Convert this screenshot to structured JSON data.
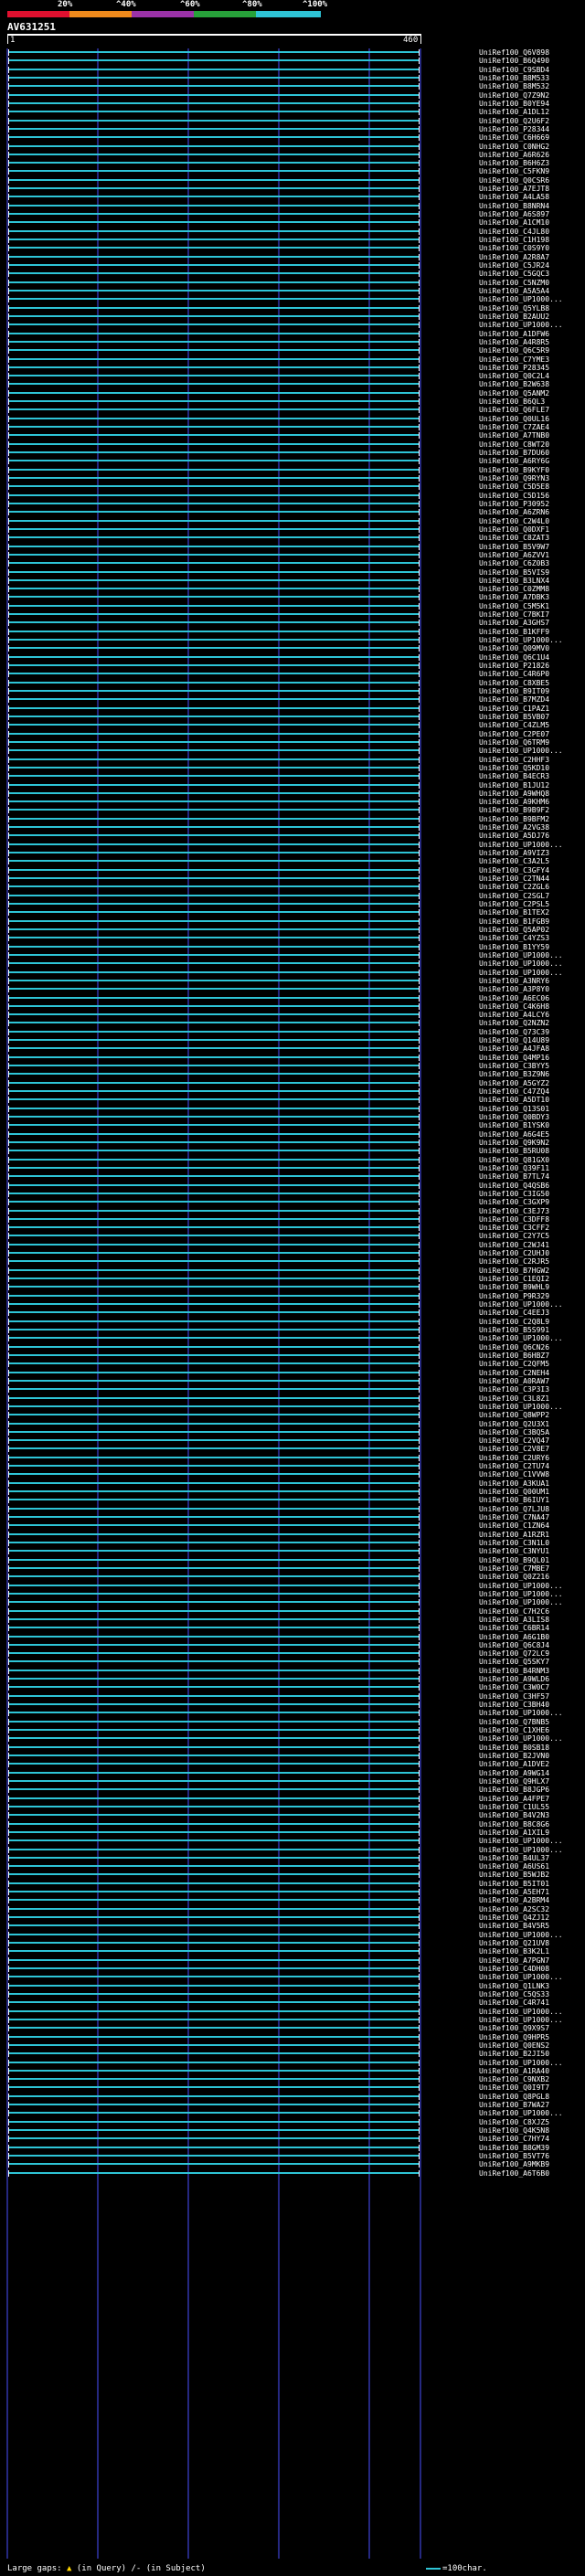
{
  "colors": {
    "background": "#000000",
    "text": "#ffffff",
    "hit_bar": "#2ec4d6",
    "identity_bar": [
      "#e0102f",
      "#f08a1c",
      "#9b32a8",
      "#27a13a",
      "#2ec4d6"
    ],
    "grid": "#4a4fff",
    "gap_marker": "#ffd400",
    "variant_bar": "#7fbf3f"
  },
  "identity_scale": {
    "labels": [
      "20%",
      "^40%",
      "^60%",
      "^80%",
      "^100%"
    ]
  },
  "query": {
    "name": "AV631251",
    "start": "1",
    "end": "460"
  },
  "hits": [
    "UniRef100_Q6V898",
    "UniRef100_B6Q490",
    "UniRef100_C9SBD4",
    "UniRef100_B8M533",
    "UniRef100_B8M532",
    "UniRef100_Q7Z9N2",
    "UniRef100_B0YE94",
    "UniRef100_A1DL12",
    "UniRef100_Q2U6F2",
    "UniRef100_P28344",
    "UniRef100_C6H669",
    "UniRef100_C0NHG2",
    "UniRef100_A6R626",
    "UniRef100_B6H6Z3",
    "UniRef100_C5FKN9",
    "UniRef100_Q0CSR6",
    "UniRef100_A7EJT8",
    "UniRef100_A4LA58",
    "UniRef100_B8NRN4",
    "UniRef100_A6S897",
    "UniRef100_A1CM10",
    "UniRef100_C4JL80",
    "UniRef100_C1H198",
    "UniRef100_C0S9Y0",
    "UniRef100_A2R8A7",
    "UniRef100_C5JR24",
    "UniRef100_C5GQC3",
    "UniRef100_C5NZM0",
    "UniRef100_A5A5A4",
    "UniRef100_UP1000...",
    "UniRef100_Q5YLB8",
    "UniRef100_B2AUU2",
    "UniRef100_UP1000...",
    "UniRef100_A1DFW6",
    "UniRef100_A4R8R5",
    "UniRef100_Q6C5R9",
    "UniRef100_C7YME3",
    "UniRef100_P28345",
    "UniRef100_Q0C2L4",
    "UniRef100_B2W638",
    "UniRef100_Q5ANM2",
    "UniRef100_B6QL3",
    "UniRef100_Q6FLE7",
    "UniRef100_Q0UL16",
    "UniRef100_C7ZAE4",
    "UniRef100_A7TNB0",
    "UniRef100_C8WT20",
    "UniRef100_B7DU60",
    "UniRef100_A6RY6G",
    "UniRef100_B9KYF0",
    "UniRef100_Q9RYN3",
    "UniRef100_C5D5E8",
    "UniRef100_C5D156",
    "UniRef100_P30952",
    "UniRef100_A6ZRN6",
    "UniRef100_C2W4L0",
    "UniRef100_Q0DXF1",
    "UniRef100_C8ZAT3",
    "UniRef100_B5V9W7",
    "UniRef100_A6ZVV1",
    "UniRef100_C6Z0B3",
    "UniRef100_B5VIS9",
    "UniRef100_B3LNX4",
    "UniRef100_C0ZMM8",
    "UniRef100_A7DBK3",
    "UniRef100_C5M5K1",
    "UniRef100_C7BKI7",
    "UniRef100_A3GHS7",
    "UniRef100_B1KFF9",
    "UniRef100_UP1000...",
    "UniRef100_Q09MV0",
    "UniRef100_Q6C1U4",
    "UniRef100_P21826",
    "UniRef100_C4R6P0",
    "UniRef100_C8XBE5",
    "UniRef100_B9IT09",
    "UniRef100_B7MZD4",
    "UniRef100_C1PAZ1",
    "UniRef100_B5VB07",
    "UniRef100_C4ZLM5",
    "UniRef100_C2PE07",
    "UniRef100_Q6TRM9",
    "UniRef100_UP1000...",
    "UniRef100_C2HHF3",
    "UniRef100_Q5KD10",
    "UniRef100_B4ECR3",
    "UniRef100_B1JU12",
    "UniRef100_A9WHQ8",
    "UniRef100_A9KHM6",
    "UniRef100_B9B9F2",
    "UniRef100_B9BFM2",
    "UniRef100_A2VG38",
    "UniRef100_A5DJ76",
    "UniRef100_UP1000...",
    "UniRef100_A9VIZ3",
    "UniRef100_C3A2L5",
    "UniRef100_C3GFY4",
    "UniRef100_C2TN44",
    "UniRef100_C2ZGL6",
    "UniRef100_C2SGL7",
    "UniRef100_C2PSL5",
    "UniRef100_B1TEX2",
    "UniRef100_B1FGB9",
    "UniRef100_Q5AP02",
    "UniRef100_C4YZS3",
    "UniRef100_B1YY59",
    "UniRef100_UP1000...",
    "UniRef100_UP1000...",
    "UniRef100_UP1000...",
    "UniRef100_A3NRY6",
    "UniRef100_A3P8Y0",
    "UniRef100_A6EC06",
    "UniRef100_C4K6H8",
    "UniRef100_A4LCY6",
    "UniRef100_Q2NZN2",
    "UniRef100_Q73C39",
    "UniRef100_Q14U89",
    "UniRef100_A4JFA8",
    "UniRef100_Q4MP16",
    "UniRef100_C3BYY5",
    "UniRef100_B3Z9N6",
    "UniRef100_A5GYZ2",
    "UniRef100_C47ZQ4",
    "UniRef100_A5DT10",
    "UniRef100_Q13S01",
    "UniRef100_Q0BDY3",
    "UniRef100_B1YSK0",
    "UniRef100_A6G4E5",
    "UniRef100_Q9K9N2",
    "UniRef100_B5RU08",
    "UniRef100_Q81GX0",
    "UniRef100_Q39F11",
    "UniRef100_B7TL74",
    "UniRef100_Q4QSB6",
    "UniRef100_C3IG50",
    "UniRef100_C3GXP9",
    "UniRef100_C3EJ73",
    "UniRef100_C3DFF8",
    "UniRef100_C3CFF2",
    "UniRef100_C2Y7C5",
    "UniRef100_C2WJ41",
    "UniRef100_C2UHJ0",
    "UniRef100_C2RJR5",
    "UniRef100_B7HGW2",
    "UniRef100_C1EQI2",
    "UniRef100_B9WHL9",
    "UniRef100_P9R329",
    "UniRef100_UP1000...",
    "UniRef100_C4EEJ3",
    "UniRef100_C2Q8L9",
    "UniRef100_B5S991",
    "UniRef100_UP1000...",
    "UniRef100_Q6CN26",
    "UniRef100_B6HBZ7",
    "UniRef100_C2QFM5",
    "UniRef100_C2NEH4",
    "UniRef100_A0RAW7",
    "UniRef100_C3P3I3",
    "UniRef100_C3L8Z1",
    "UniRef100_UP1000...",
    "UniRef100_Q8WPP2",
    "UniRef100_Q2U3X1",
    "UniRef100_C3BQ5A",
    "UniRef100_C2VQ47",
    "UniRef100_C2V8E7",
    "UniRef100_C2URY6",
    "UniRef100_C2TU74",
    "UniRef100_C1VVW8",
    "UniRef100_A3KUA1",
    "UniRef100_Q00UM1",
    "UniRef100_B6IUY1",
    "UniRef100_Q7LJU8",
    "UniRef100_C7NA47",
    "UniRef100_C1ZN64",
    "UniRef100_A1RZR1",
    "UniRef100_C3N1L0",
    "UniRef100_C3NYU1",
    "UniRef100_B9QL01",
    "UniRef100_C7MBE7",
    "UniRef100_Q0Z216",
    "UniRef100_UP1000...",
    "UniRef100_UP1000...",
    "UniRef100_UP1000...",
    "UniRef100_C7H2C6",
    "UniRef100_A3LIS8",
    "UniRef100_C6BR14",
    "UniRef100_A6G1B0",
    "UniRef100_Q6C8J4",
    "UniRef100_Q72LC9",
    "UniRef100_Q5SKY7",
    "UniRef100_B4RNM3",
    "UniRef100_A9WLD6",
    "UniRef100_C3W0C7",
    "UniRef100_C3HF57",
    "UniRef100_C3BH40",
    "UniRef100_UP1000...",
    "UniRef100_Q7BNB5",
    "UniRef100_C1XHE6",
    "UniRef100_UP1000...",
    "UniRef100_B0SB18",
    "UniRef100_B2JVN0",
    "UniRef100_A1DVE2",
    "UniRef100_A9WG14",
    "UniRef100_Q9HLX7",
    "UniRef100_B8JGP6",
    "UniRef100_A4FPE7",
    "UniRef100_C1UL55",
    "UniRef100_B4V2N3",
    "UniRef100_B8C8G6",
    "UniRef100_A1XIL9",
    "UniRef100_UP1000...",
    "UniRef100_UP1000...",
    "UniRef100_B4UL37",
    "UniRef100_A6US61",
    "UniRef100_B5WJB2",
    "UniRef100_B5IT01",
    "UniRef100_A5EH71",
    "UniRef100_A2BRM4",
    "UniRef100_A2SC32",
    "UniRef100_Q4ZJ12",
    "UniRef100_B4V5R5",
    "UniRef100_UP1000...",
    "UniRef100_Q21UV8",
    "UniRef100_B3K2L1",
    "UniRef100_A7PGN7",
    "UniRef100_C4DH08",
    "UniRef100_UP1000...",
    "UniRef100_Q1LNK3",
    "UniRef100_C5QS33",
    "UniRef100_C4R741",
    "UniRef100_UP1000...",
    "UniRef100_UP1000...",
    "UniRef100_Q9X9S7",
    "UniRef100_Q9HPR5",
    "UniRef100_Q0ENS2",
    "UniRef100_B2JI50",
    "UniRef100_UP1000...",
    "UniRef100_A1RA40",
    "UniRef100_C9NXB2",
    "UniRef100_Q0I9T7",
    "UniRef100_Q8PGL8",
    "UniRef100_B7WA27",
    "UniRef100_UP1000...",
    "UniRef100_C8XJZ5",
    "UniRef100_Q4K5N8",
    "UniRef100_C7HY74",
    "UniRef100_B8GM39",
    "UniRef100_B5VT76",
    "UniRef100_A9MKB9",
    "UniRef100_A6T6B0"
  ],
  "footer": {
    "large_gaps_label": "Large gaps:",
    "gap_query": "(in Query)",
    "gap_subject": "/- (in Subject)",
    "scale_label": "=100char."
  }
}
